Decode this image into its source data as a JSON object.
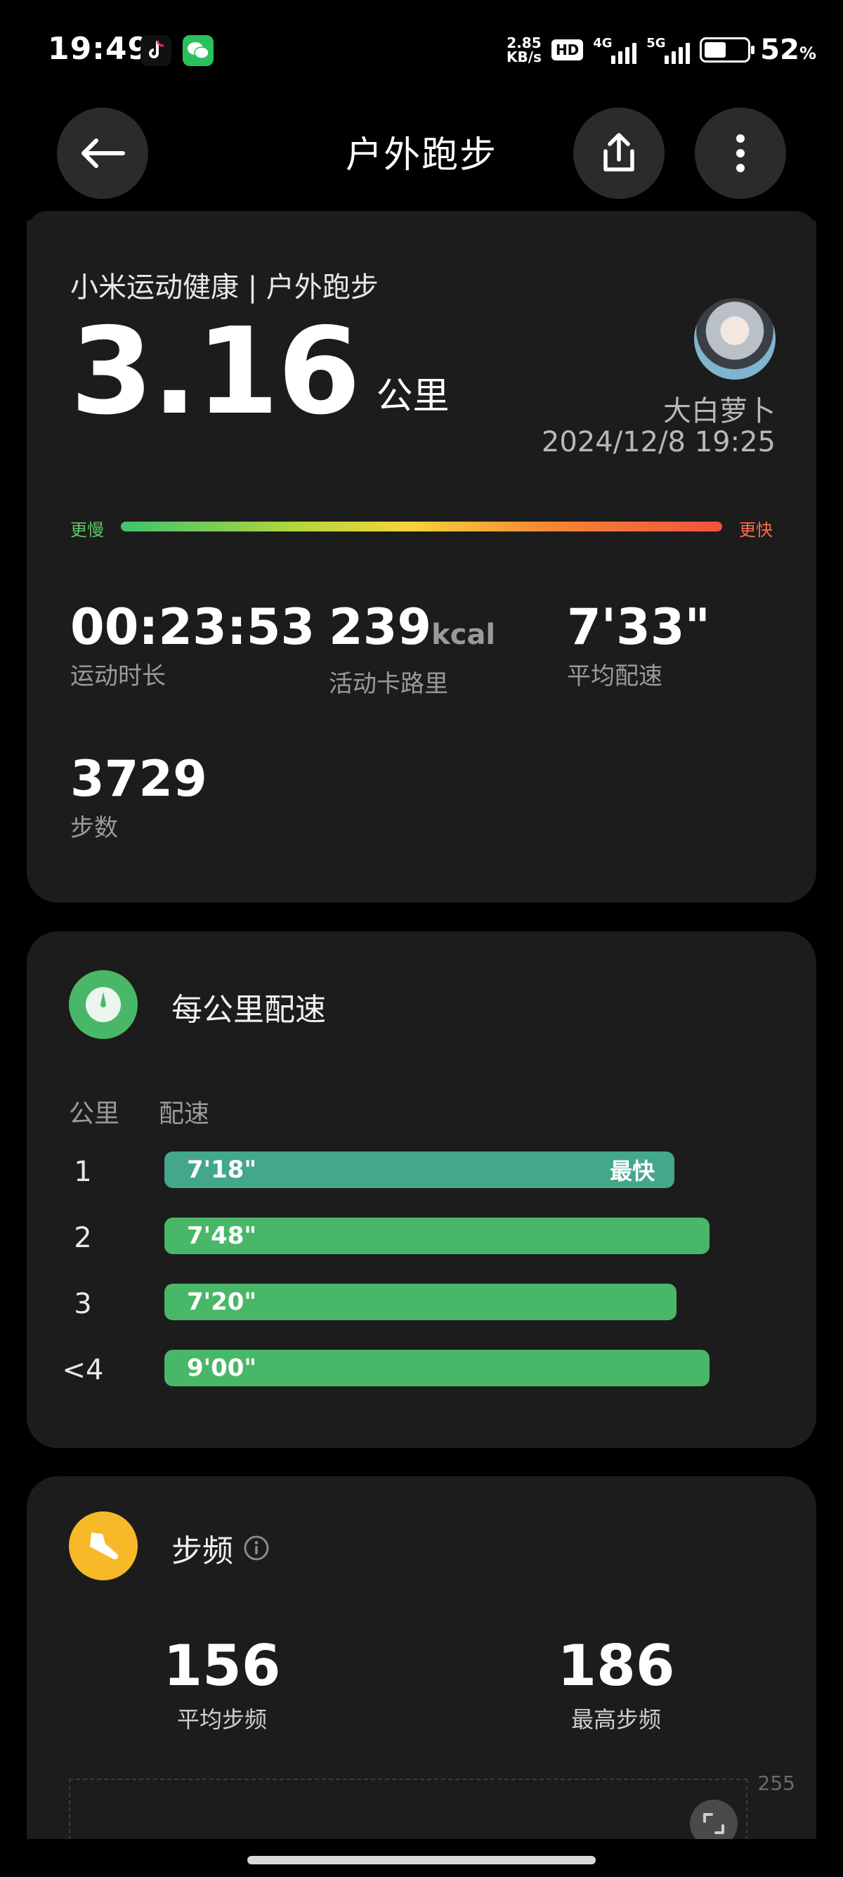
{
  "status_bar": {
    "time": "19:49",
    "net_speed_value": "2.85",
    "net_speed_unit": "KB/s",
    "hd_badge": "HD",
    "sim1_network": "4G",
    "sim2_network": "5G",
    "battery_percent": "52",
    "battery_symbol": "%",
    "battery_level": 0.52,
    "apps": [
      "tiktok-icon",
      "wechat-icon"
    ]
  },
  "header": {
    "title": "户外跑步",
    "back_icon": "back-arrow-icon",
    "share_icon": "share-icon",
    "more_icon": "more-vertical-icon"
  },
  "summary": {
    "brand": "小米运动健康 | 户外跑步",
    "distance": "3.16",
    "distance_unit": "公里",
    "username": "大白萝卜",
    "datetime": "2024/12/8 19:25",
    "speed_slow_label": "更慢",
    "speed_fast_label": "更快",
    "duration": "00:23:53",
    "duration_label": "运动时长",
    "calories": "239",
    "calories_unit": "kcal",
    "calories_label": "活动卡路里",
    "avg_pace": "7'33\"",
    "avg_pace_label": "平均配速",
    "steps": "3729",
    "steps_label": "步数"
  },
  "pace_card": {
    "title": "每公里配速",
    "icon": "stopwatch-icon",
    "col_km": "公里",
    "col_pace": "配速",
    "fastest_badge": "最快",
    "rows": [
      {
        "km": "1",
        "pace": "7'18\"",
        "fastest": true,
        "bar_fraction": 0.935
      },
      {
        "km": "2",
        "pace": "7'48\"",
        "fastest": false,
        "bar_fraction": 1.0
      },
      {
        "km": "3",
        "pace": "7'20\"",
        "fastest": false,
        "bar_fraction": 0.94
      },
      {
        "km": "<4",
        "pace": "9'00\"",
        "fastest": false,
        "bar_fraction": 1.0
      }
    ],
    "accent": "#49b768"
  },
  "cadence_card": {
    "title": "步频",
    "icon": "shoe-icon",
    "info_icon": "info-icon",
    "avg_value": "156",
    "avg_label": "平均步频",
    "max_value": "186",
    "max_label": "最高步频",
    "chart_max": "255",
    "expand_icon": "expand-icon",
    "accent": "#f7b928"
  }
}
